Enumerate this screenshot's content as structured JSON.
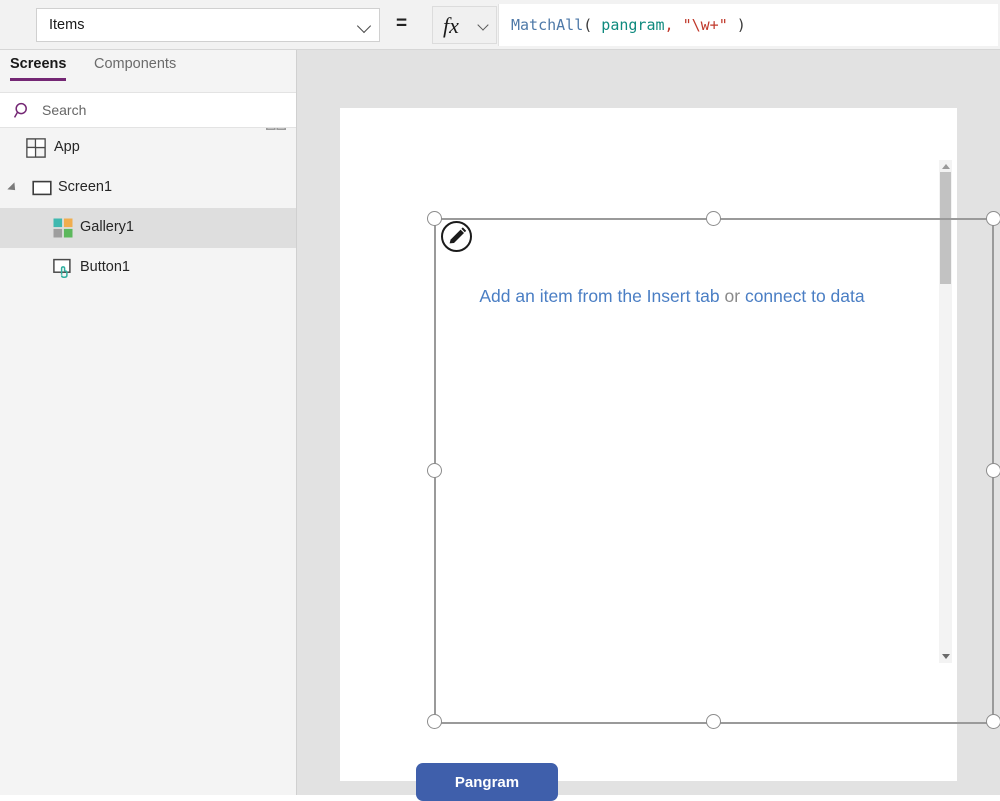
{
  "formula_bar": {
    "property_selected": "Items",
    "equals": "=",
    "fx_label": "fx",
    "formula_tokens": [
      {
        "text": "MatchAll",
        "color": "#4e79a8"
      },
      {
        "text": "(",
        "color": "#3a3a3a"
      },
      {
        "text": " pangram",
        "color": "#0f8a7e"
      },
      {
        "text": ",",
        "color": "#c0392b"
      },
      {
        "text": " ",
        "color": "#3a3a3a"
      },
      {
        "text": "\"\\w+\"",
        "color": "#c0392b"
      },
      {
        "text": " )",
        "color": "#3a3a3a"
      }
    ],
    "formula_plain": "MatchAll( pangram, \"\\w+\" )"
  },
  "left_panel": {
    "tabs": [
      {
        "id": "screens",
        "label": "Screens",
        "active": true
      },
      {
        "id": "components",
        "label": "Components",
        "active": false
      }
    ],
    "toolbar_icons": [
      {
        "name": "tree-filter-icon",
        "color": "#742774"
      },
      {
        "name": "grid-view-icon",
        "color": "#9b9b9b"
      }
    ],
    "search": {
      "placeholder": "Search",
      "value": "",
      "icon": "search-icon",
      "icon_color": "#742774"
    },
    "tree": [
      {
        "id": "app",
        "label": "App",
        "icon": "app-icon",
        "selected": false,
        "depth": 0
      },
      {
        "id": "screen1",
        "label": "Screen1",
        "icon": "screen-icon",
        "selected": false,
        "depth": 0,
        "expanded": true
      },
      {
        "id": "gallery1",
        "label": "Gallery1",
        "icon": "gallery-icon",
        "selected": true,
        "depth": 1
      },
      {
        "id": "button1",
        "label": "Button1",
        "icon": "button-icon",
        "selected": false,
        "depth": 1
      }
    ]
  },
  "canvas": {
    "gallery": {
      "name": "Gallery1",
      "selected": true,
      "empty_message": {
        "link_1": "Add an item from the Insert tab",
        "separator": " or ",
        "link_2": "connect to data"
      },
      "edit_button_icon": "pencil-icon",
      "scrollbar": {
        "up_arrow": "chevron-up-icon",
        "down_arrow": "chevron-down-icon"
      }
    },
    "button": {
      "label": "Pangram",
      "fill_color": "#3f5fab",
      "text_color": "#ffffff"
    }
  },
  "colors": {
    "accent_purple": "#742774",
    "link_blue": "#4a7ec4",
    "button_blue": "#3f5fab",
    "canvas_bg": "#e2e2e2",
    "panel_bg": "#f4f4f4"
  }
}
